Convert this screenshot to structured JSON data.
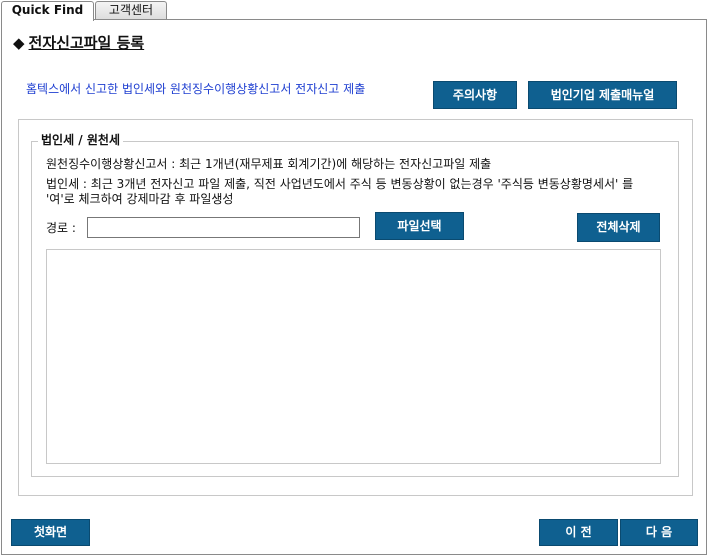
{
  "tabs": [
    {
      "label": "Quick Find"
    },
    {
      "label": "고객센터"
    }
  ],
  "page": {
    "title_marker": "◆",
    "title": "전자신고파일 등록",
    "notice": "홈텍스에서 신고한 법인세와 원천징수이행상황신고서 전자신고 제출"
  },
  "buttons": {
    "caution": "주의사항",
    "manual": "법인기업 제출매뉴얼",
    "select_file": "파일선택",
    "delete_all": "전체삭제",
    "home": "첫화면",
    "prev": "이 전",
    "next": "다 음"
  },
  "section": {
    "legend": "법인세 / 원천세",
    "desc_withholding": "원천징수이행상황신고서 : 최근 1개년(재무제표 회계기간)에 해당하는 전자신고파일 제출",
    "desc_corporate": "법인세 : 최근 3개년 전자신고 파일 제출, 직전 사업년도에서 주식 등 변동상황이 없는경우 '주식등 변동상황명세서' 를 '여'로 체크하여 강제마감 후 파일생성",
    "path_label": "경로 :",
    "path_value": ""
  },
  "colors": {
    "button_bg": "#0f6090",
    "notice_text": "#1f3fd1"
  }
}
